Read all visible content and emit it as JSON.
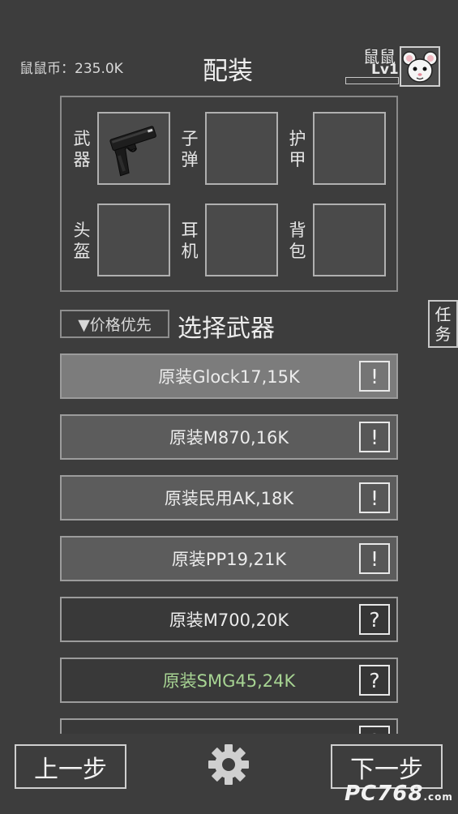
{
  "header": {
    "coins": "鼠鼠币：235.0K",
    "title": "配装",
    "username": "鼠鼠",
    "level": "Lv1",
    "level_progress": 0
  },
  "equipment": {
    "slots": [
      {
        "label": "武器",
        "filled": true,
        "icon": "pistol-icon"
      },
      {
        "label": "子弹",
        "filled": false
      },
      {
        "label": "护甲",
        "filled": false
      },
      {
        "label": "头盔",
        "filled": false
      },
      {
        "label": "耳机",
        "filled": false
      },
      {
        "label": "背包",
        "filled": false
      }
    ]
  },
  "sort": {
    "label": "▼价格优先"
  },
  "section_title": "选择武器",
  "side_tab": {
    "label_line1": "任",
    "label_line2": "务"
  },
  "weapons": [
    {
      "label": "原装Glock17,15K",
      "mark": "!",
      "state": "selected"
    },
    {
      "label": "原装M870,16K",
      "mark": "!",
      "state": "available"
    },
    {
      "label": "原装民用AK,18K",
      "mark": "!",
      "state": "available"
    },
    {
      "label": "原装PP19,21K",
      "mark": "!",
      "state": "available"
    },
    {
      "label": "原装M700,20K",
      "mark": "?",
      "state": "locked"
    },
    {
      "label": "原装SMG45,24K",
      "mark": "?",
      "state": "locked-green"
    },
    {
      "label": "",
      "mark": "?",
      "state": "locked"
    }
  ],
  "nav": {
    "prev": "上一步",
    "next": "下一步",
    "settings_icon": "gear-icon"
  },
  "watermark": {
    "main": "PC768",
    "suffix": ".com"
  },
  "colors": {
    "background": "#3d3d3d",
    "highlight": "#7c7c7c",
    "green_text": "#a7d493"
  }
}
